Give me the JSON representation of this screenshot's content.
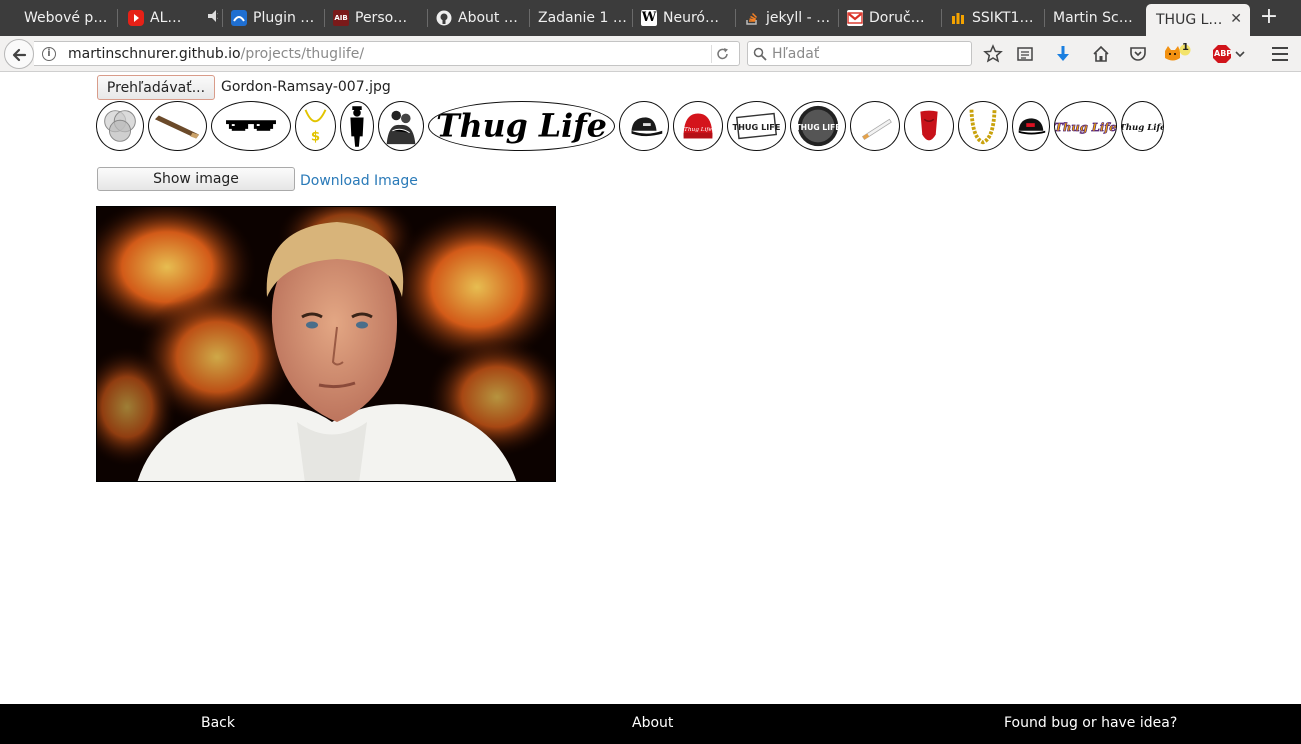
{
  "browser": {
    "tabs": [
      {
        "label": "Webové p…",
        "favicon": "none"
      },
      {
        "label": "AL…",
        "favicon": "youtube-icon",
        "audio": true
      },
      {
        "label": "Plugin …",
        "favicon": "plugin-icon"
      },
      {
        "label": "Perso…",
        "favicon": "aib-icon"
      },
      {
        "label": "About …",
        "favicon": "github-icon"
      },
      {
        "label": "Zadanie 1 …",
        "favicon": "none"
      },
      {
        "label": "Neuró…",
        "favicon": "wikipedia-icon"
      },
      {
        "label": "jekyll - …",
        "favicon": "stackoverflow-icon"
      },
      {
        "label": "Doruč…",
        "favicon": "gmail-icon"
      },
      {
        "label": "SSIKT1…",
        "favicon": "bars-icon"
      },
      {
        "label": "Martin Sc…",
        "favicon": "none"
      },
      {
        "label": "THUG L…",
        "favicon": "none",
        "active": true
      }
    ],
    "new_tab": "+",
    "url_host": "martinschnurer.github.io",
    "url_path": "/projects/thuglife/",
    "search_placeholder": "Hľadať",
    "badge_count": "1",
    "abp_label": "ABP"
  },
  "page": {
    "browse_label": "Prehľadávať...",
    "file_name": "Gordon-Ramsay-007.jpg",
    "stickers": [
      {
        "name": "none-sticker",
        "label": ""
      },
      {
        "name": "joint-sticker",
        "label": ""
      },
      {
        "name": "sunglasses-sticker",
        "label": ""
      },
      {
        "name": "dollar-chain-sticker",
        "label": ""
      },
      {
        "name": "gangster-figure-sticker",
        "label": ""
      },
      {
        "name": "gangster-group-sticker",
        "label": ""
      },
      {
        "name": "thug-life-text-sticker",
        "label": "Thug Life"
      },
      {
        "name": "black-cap-sticker",
        "label": ""
      },
      {
        "name": "red-beanie-sticker",
        "label": "Thug Life"
      },
      {
        "name": "thug-life-logo-sticker",
        "label": "THUG LIFE"
      },
      {
        "name": "thug-life-dark-logo-sticker",
        "label": "THUG LIFE"
      },
      {
        "name": "cigarette-sticker",
        "label": ""
      },
      {
        "name": "red-bandana-sticker",
        "label": ""
      },
      {
        "name": "gold-chain-sticker",
        "label": ""
      },
      {
        "name": "obey-cap-sticker",
        "label": ""
      },
      {
        "name": "thug-life-gold-sticker",
        "label": "Thug Life"
      },
      {
        "name": "thug-life-script-sticker",
        "label": "Thug Life"
      }
    ],
    "show_image_label": "Show image",
    "download_label": "Download Image"
  },
  "footer": {
    "back": "Back",
    "about": "About",
    "bug": "Found bug or have idea?"
  },
  "colors": {
    "tabstrip": "#3c3c3c",
    "toolbar": "#f2f1f0",
    "link": "#2a7ab8",
    "footer": "#000000"
  }
}
